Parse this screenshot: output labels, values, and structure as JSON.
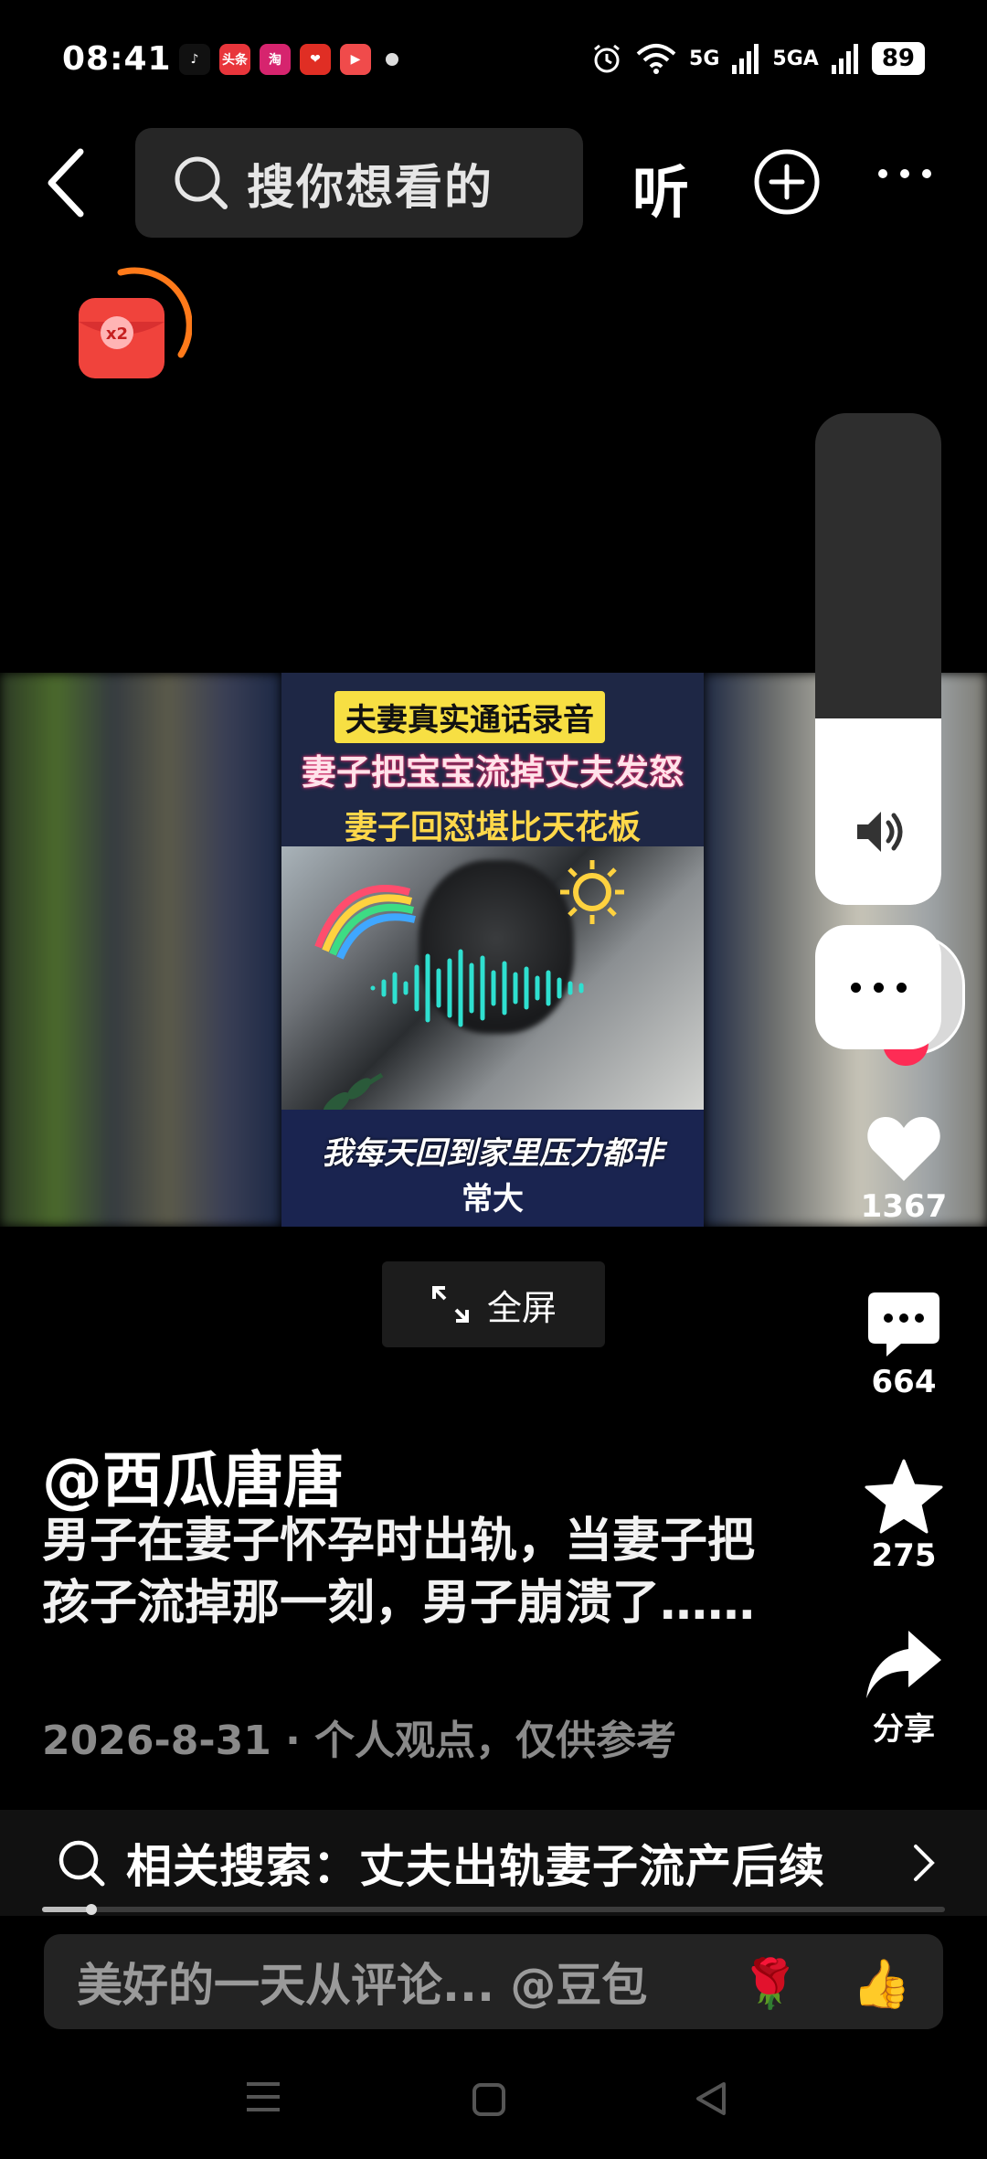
{
  "status_bar": {
    "time": "08:41",
    "app_icons": [
      {
        "name": "douyin-icon",
        "color": "#111111",
        "glyph": "♪"
      },
      {
        "name": "toutiao-icon",
        "color": "#e8353b",
        "glyph": "头条"
      },
      {
        "name": "shop-icon",
        "color": "#d6246e",
        "glyph": "淘"
      },
      {
        "name": "pinduoduo-icon",
        "color": "#e02e24",
        "glyph": "❤"
      },
      {
        "name": "video-app-icon",
        "color": "#f04b4b",
        "glyph": "▶"
      }
    ],
    "network_1": "5G",
    "network_2": "5GA",
    "battery": "89"
  },
  "top_bar": {
    "search_placeholder": "搜你想看的",
    "listen_label": "听"
  },
  "video": {
    "title_line1": "夫妻真实通话录音",
    "title_line2": "妻子把宝宝流掉丈夫发怒",
    "title_line3": "妻子回怼堪比天花板",
    "subtitle_line1": "我每天回到家里压力都非",
    "subtitle_line2": "常大"
  },
  "volume": {
    "level": 0.38
  },
  "actions": {
    "likes": "1367",
    "comments": "664",
    "favorites": "275",
    "share_label": "分享"
  },
  "fullscreen_label": "全屏",
  "post": {
    "author": "@西瓜唐唐",
    "description": "男子在妻子怀孕时出轨，当妻子把孩子流掉那一刻，男子崩溃了……",
    "meta": "2026-8-31 · 个人观点，仅供参考"
  },
  "related_search": {
    "text": "相关搜索：丈夫出轨妻子流产后续"
  },
  "playback": {
    "progress": 0.055
  },
  "comment_bar": {
    "placeholder": "美好的一天从评论... @豆包",
    "emoji_1": "🌹",
    "emoji_2": "👍"
  },
  "colors": {
    "background": "#000000",
    "accent_red": "#fe2c55",
    "caption_yellow": "#f7df43",
    "muted_text": "#8a8a8a"
  }
}
